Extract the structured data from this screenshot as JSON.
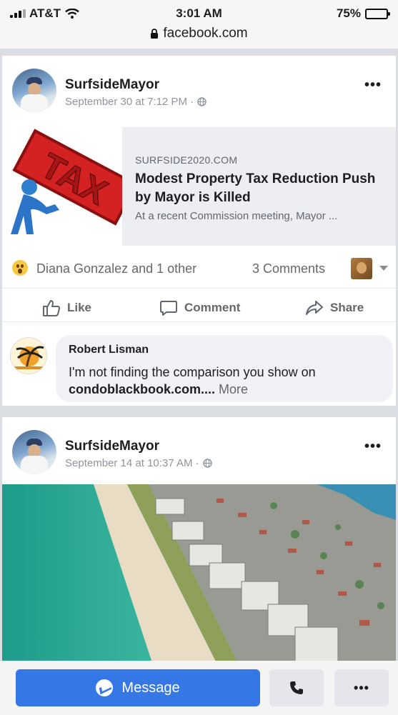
{
  "status_bar": {
    "carrier": "AT&T",
    "time": "3:01 AM",
    "battery": "75%",
    "battery_level": 0.75,
    "url": "facebook.com"
  },
  "post1": {
    "author": "SurfsideMayor",
    "timestamp": "September 30 at 7:12 PM ·",
    "link": {
      "domain": "SURFSIDE2020.COM",
      "title": "Modest Property Tax Reduction Push by Mayor is Killed",
      "description": "At a recent Commission meeting, Mayor ...",
      "thumb_text": "TAX"
    },
    "reactions": {
      "text": "Diana Gonzalez and 1 other",
      "comments": "3 Comments"
    },
    "actions": {
      "like": "Like",
      "comment": "Comment",
      "share": "Share"
    },
    "comment": {
      "author": "Robert Lisman",
      "text": "I'm not finding the comparison you show on ",
      "link_text": "condoblackbook.com....",
      "more": " More"
    }
  },
  "post2": {
    "author": "SurfsideMayor",
    "timestamp": "September 14 at 10:37 AM ·"
  },
  "bottom_bar": {
    "message_label": "Message"
  },
  "colors": {
    "primary": "#3578e5",
    "secondary_text": "#65676b",
    "divider": "#dadde1"
  }
}
